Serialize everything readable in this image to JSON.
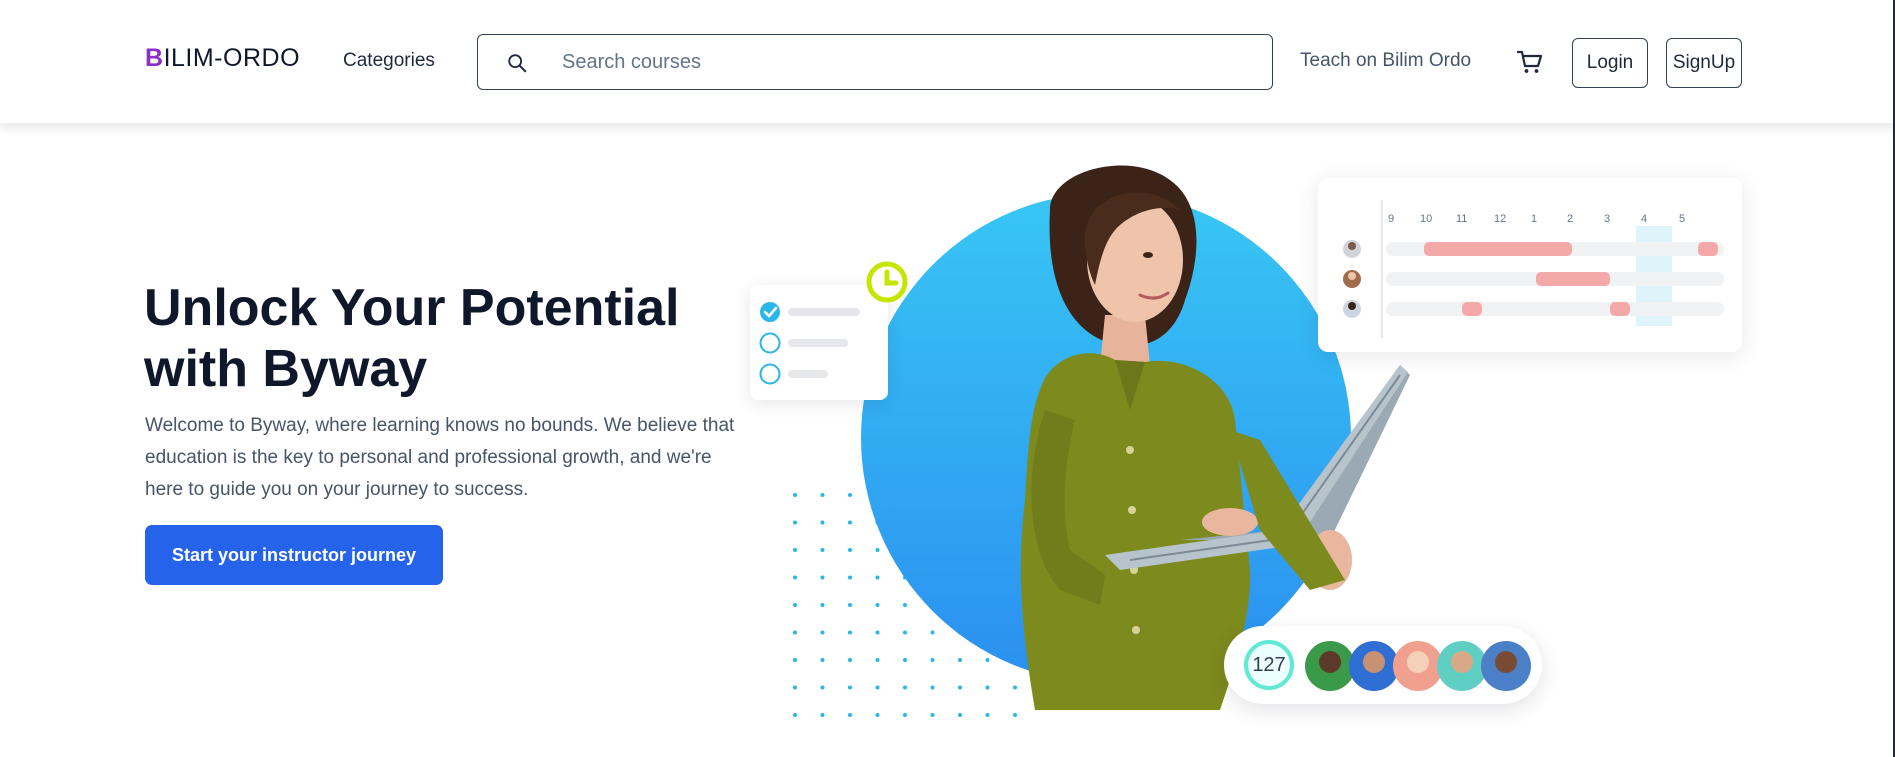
{
  "header": {
    "logo_first": "B",
    "logo_rest": "ILIM-ORDO",
    "categories_label": "Categories",
    "search_placeholder": "Search courses",
    "teach_label": "Teach on Bilim Ordo",
    "cart_icon": "shopping-cart-icon",
    "login_label": "Login",
    "signup_label": "SignUp"
  },
  "hero": {
    "title": "Unlock Your Potential with Byway",
    "text": "Welcome to Byway, where learning knows no bounds. We believe that education is the key to personal and professional growth, and we're here to guide you on your journey to success.",
    "cta_label": "Start your instructor journey"
  },
  "illustration": {
    "schedule_times": [
      "9",
      "10",
      "11",
      "12",
      "1",
      "2",
      "3",
      "4",
      "5"
    ],
    "learner_count": "127"
  },
  "colors": {
    "logo_accent": "#8b2fc9",
    "primary": "#2563eb",
    "circle_top": "#38c6f4",
    "circle_bottom": "#2b8ff0",
    "schedule_bar": "#f4a9a8",
    "check_blue": "#29b6e8",
    "clock_green": "#c4e600"
  }
}
